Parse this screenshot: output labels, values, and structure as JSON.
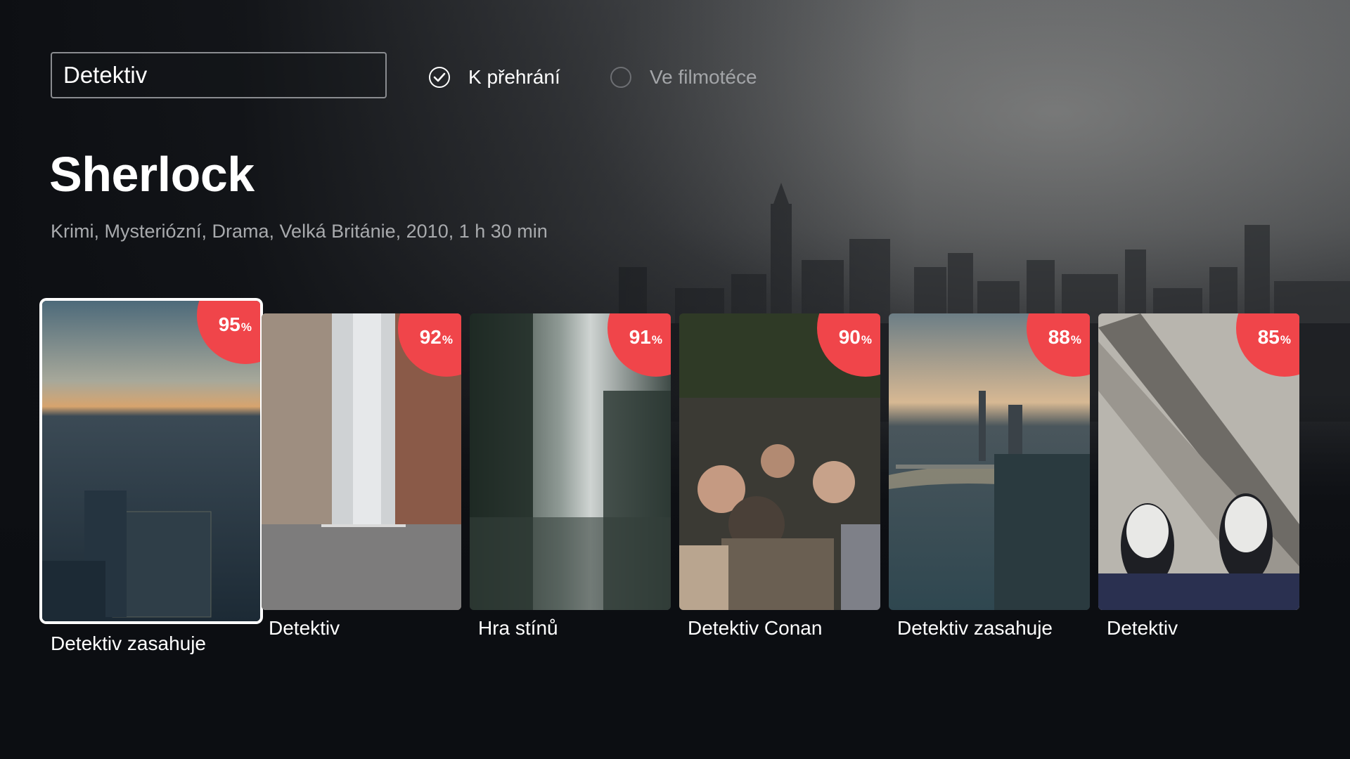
{
  "search": {
    "value": "Detektiv"
  },
  "filters": [
    {
      "label": "K přehrání",
      "checked": true
    },
    {
      "label": "Ve filmotéce",
      "checked": false
    }
  ],
  "hero": {
    "title": "Sherlock",
    "meta": "Krimi, Mysteriózní, Drama, Velká Británie, 2010, 1 h 30 min"
  },
  "results": [
    {
      "title": "Detektiv zasahuje",
      "score": "95",
      "score_unit": "%",
      "focused": true,
      "art": "city-dusk-aerial"
    },
    {
      "title": "Detektiv",
      "score": "92",
      "score_unit": "%",
      "focused": false,
      "art": "city-street-canyon"
    },
    {
      "title": "Hra stínů",
      "score": "91",
      "score_unit": "%",
      "focused": false,
      "art": "rainy-window"
    },
    {
      "title": "Detektiv Conan",
      "score": "90",
      "score_unit": "%",
      "focused": false,
      "art": "crowd"
    },
    {
      "title": "Detektiv zasahuje",
      "score": "88",
      "score_unit": "%",
      "focused": false,
      "art": "river-city"
    },
    {
      "title": "Detektiv",
      "score": "85",
      "score_unit": "%",
      "focused": false,
      "art": "sneakers-asphalt"
    }
  ],
  "colors": {
    "background": "#0d0f13",
    "badge": "#f0454a",
    "focus_ring": "#ffffff"
  }
}
